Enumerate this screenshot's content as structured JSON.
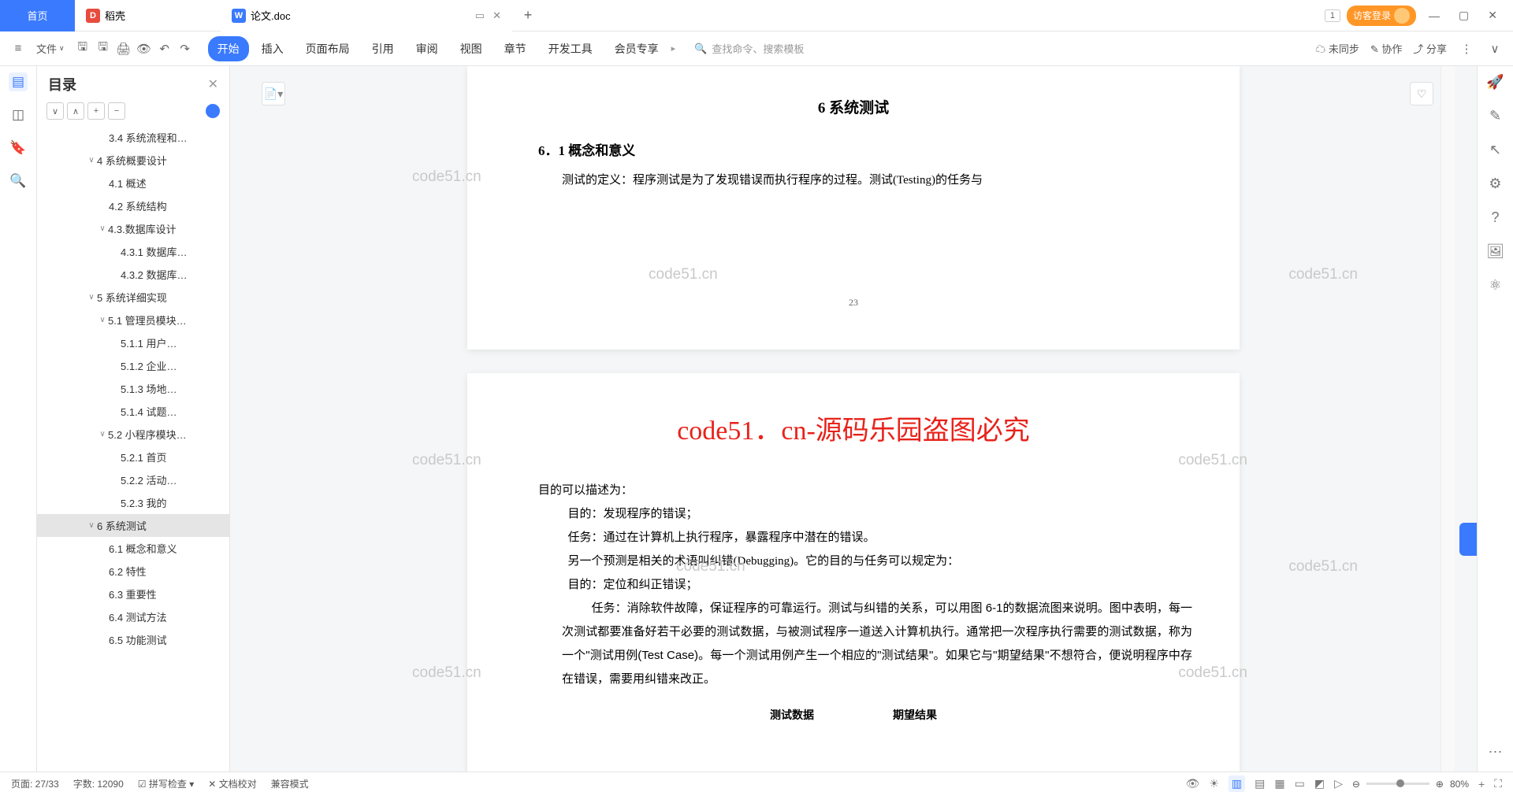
{
  "tabs": {
    "home": "首页",
    "dao": "稻壳",
    "doc": "论文.doc"
  },
  "login": "访客登录",
  "file_label": "文件",
  "menus": [
    "开始",
    "插入",
    "页面布局",
    "引用",
    "审阅",
    "视图",
    "章节",
    "开发工具",
    "会员专享"
  ],
  "search_placeholder": "查找命令、搜索模板",
  "sync": "未同步",
  "coop": "协作",
  "share": "分享",
  "outline_title": "目录",
  "outline": [
    {
      "t": "3.4 系统流程和…",
      "pad": 105
    },
    {
      "t": "4 系统概要设计",
      "pad": 76,
      "chev": "∨"
    },
    {
      "t": "4.1 概述",
      "pad": 105
    },
    {
      "t": "4.2 系统结构",
      "pad": 105
    },
    {
      "t": "4.3.数据库设计",
      "pad": 90,
      "chev": "∨"
    },
    {
      "t": "4.3.1 数据库…",
      "pad": 120
    },
    {
      "t": "4.3.2 数据库…",
      "pad": 120
    },
    {
      "t": "5 系统详细实现",
      "pad": 76,
      "chev": "∨"
    },
    {
      "t": "5.1 管理员模块…",
      "pad": 90,
      "chev": "∨"
    },
    {
      "t": "5.1.1 用户…",
      "pad": 120
    },
    {
      "t": "5.1.2 企业…",
      "pad": 120
    },
    {
      "t": "5.1.3 场地…",
      "pad": 120
    },
    {
      "t": "5.1.4 试题…",
      "pad": 120
    },
    {
      "t": "5.2 小程序模块…",
      "pad": 90,
      "chev": "∨"
    },
    {
      "t": "5.2.1 首页",
      "pad": 120
    },
    {
      "t": "5.2.2 活动…",
      "pad": 120
    },
    {
      "t": "5.2.3 我的",
      "pad": 120
    },
    {
      "t": "6 系统测试",
      "pad": 76,
      "chev": "∨",
      "sel": true
    },
    {
      "t": "6.1 概念和意义",
      "pad": 105
    },
    {
      "t": "6.2 特性",
      "pad": 105
    },
    {
      "t": "6.3 重要性",
      "pad": 105
    },
    {
      "t": "6.4 测试方法",
      "pad": 105
    },
    {
      "t": "6.5 功能测试",
      "pad": 105
    }
  ],
  "doc": {
    "h1": "6 系统测试",
    "h2": "6．1 概念和意义",
    "p1": "测试的定义：程序测试是为了发现错误而执行程序的过程。测试(Testing)的任务与",
    "pgnum": "23",
    "banner": "code51．cn-源码乐园盗图必究",
    "p2": "目的可以描述为：",
    "l1": "目的：发现程序的错误；",
    "l2": "任务：通过在计算机上执行程序，暴露程序中潜在的错误。",
    "l3": "另一个预测是相关的术语叫纠错(Debugging)。它的目的与任务可以规定为：",
    "l4": "目的：定位和纠正错误；",
    "p3": "任务：消除软件故障，保证程序的可靠运行。测试与纠错的关系，可以用图 6-1的数据流图来说明。图中表明，每一次测试都要准备好若干必要的测试数据，与被测试程序一道送入计算机执行。通常把一次程序执行需要的测试数据，称为一个\"测试用例(Test Case)。每一个测试用例产生一个相应的\"测试结果\"。如果它与\"期望结果\"不想符合，便说明程序中存在错误，需要用纠错来改正。",
    "chart_l": "测试数据",
    "chart_r": "期望结果",
    "wm": "code51.cn"
  },
  "status": {
    "page": "页面: 27/33",
    "words": "字数: 12090",
    "spell": "拼写检查",
    "proof": "文档校对",
    "compat": "兼容模式",
    "zoom": "80%"
  }
}
